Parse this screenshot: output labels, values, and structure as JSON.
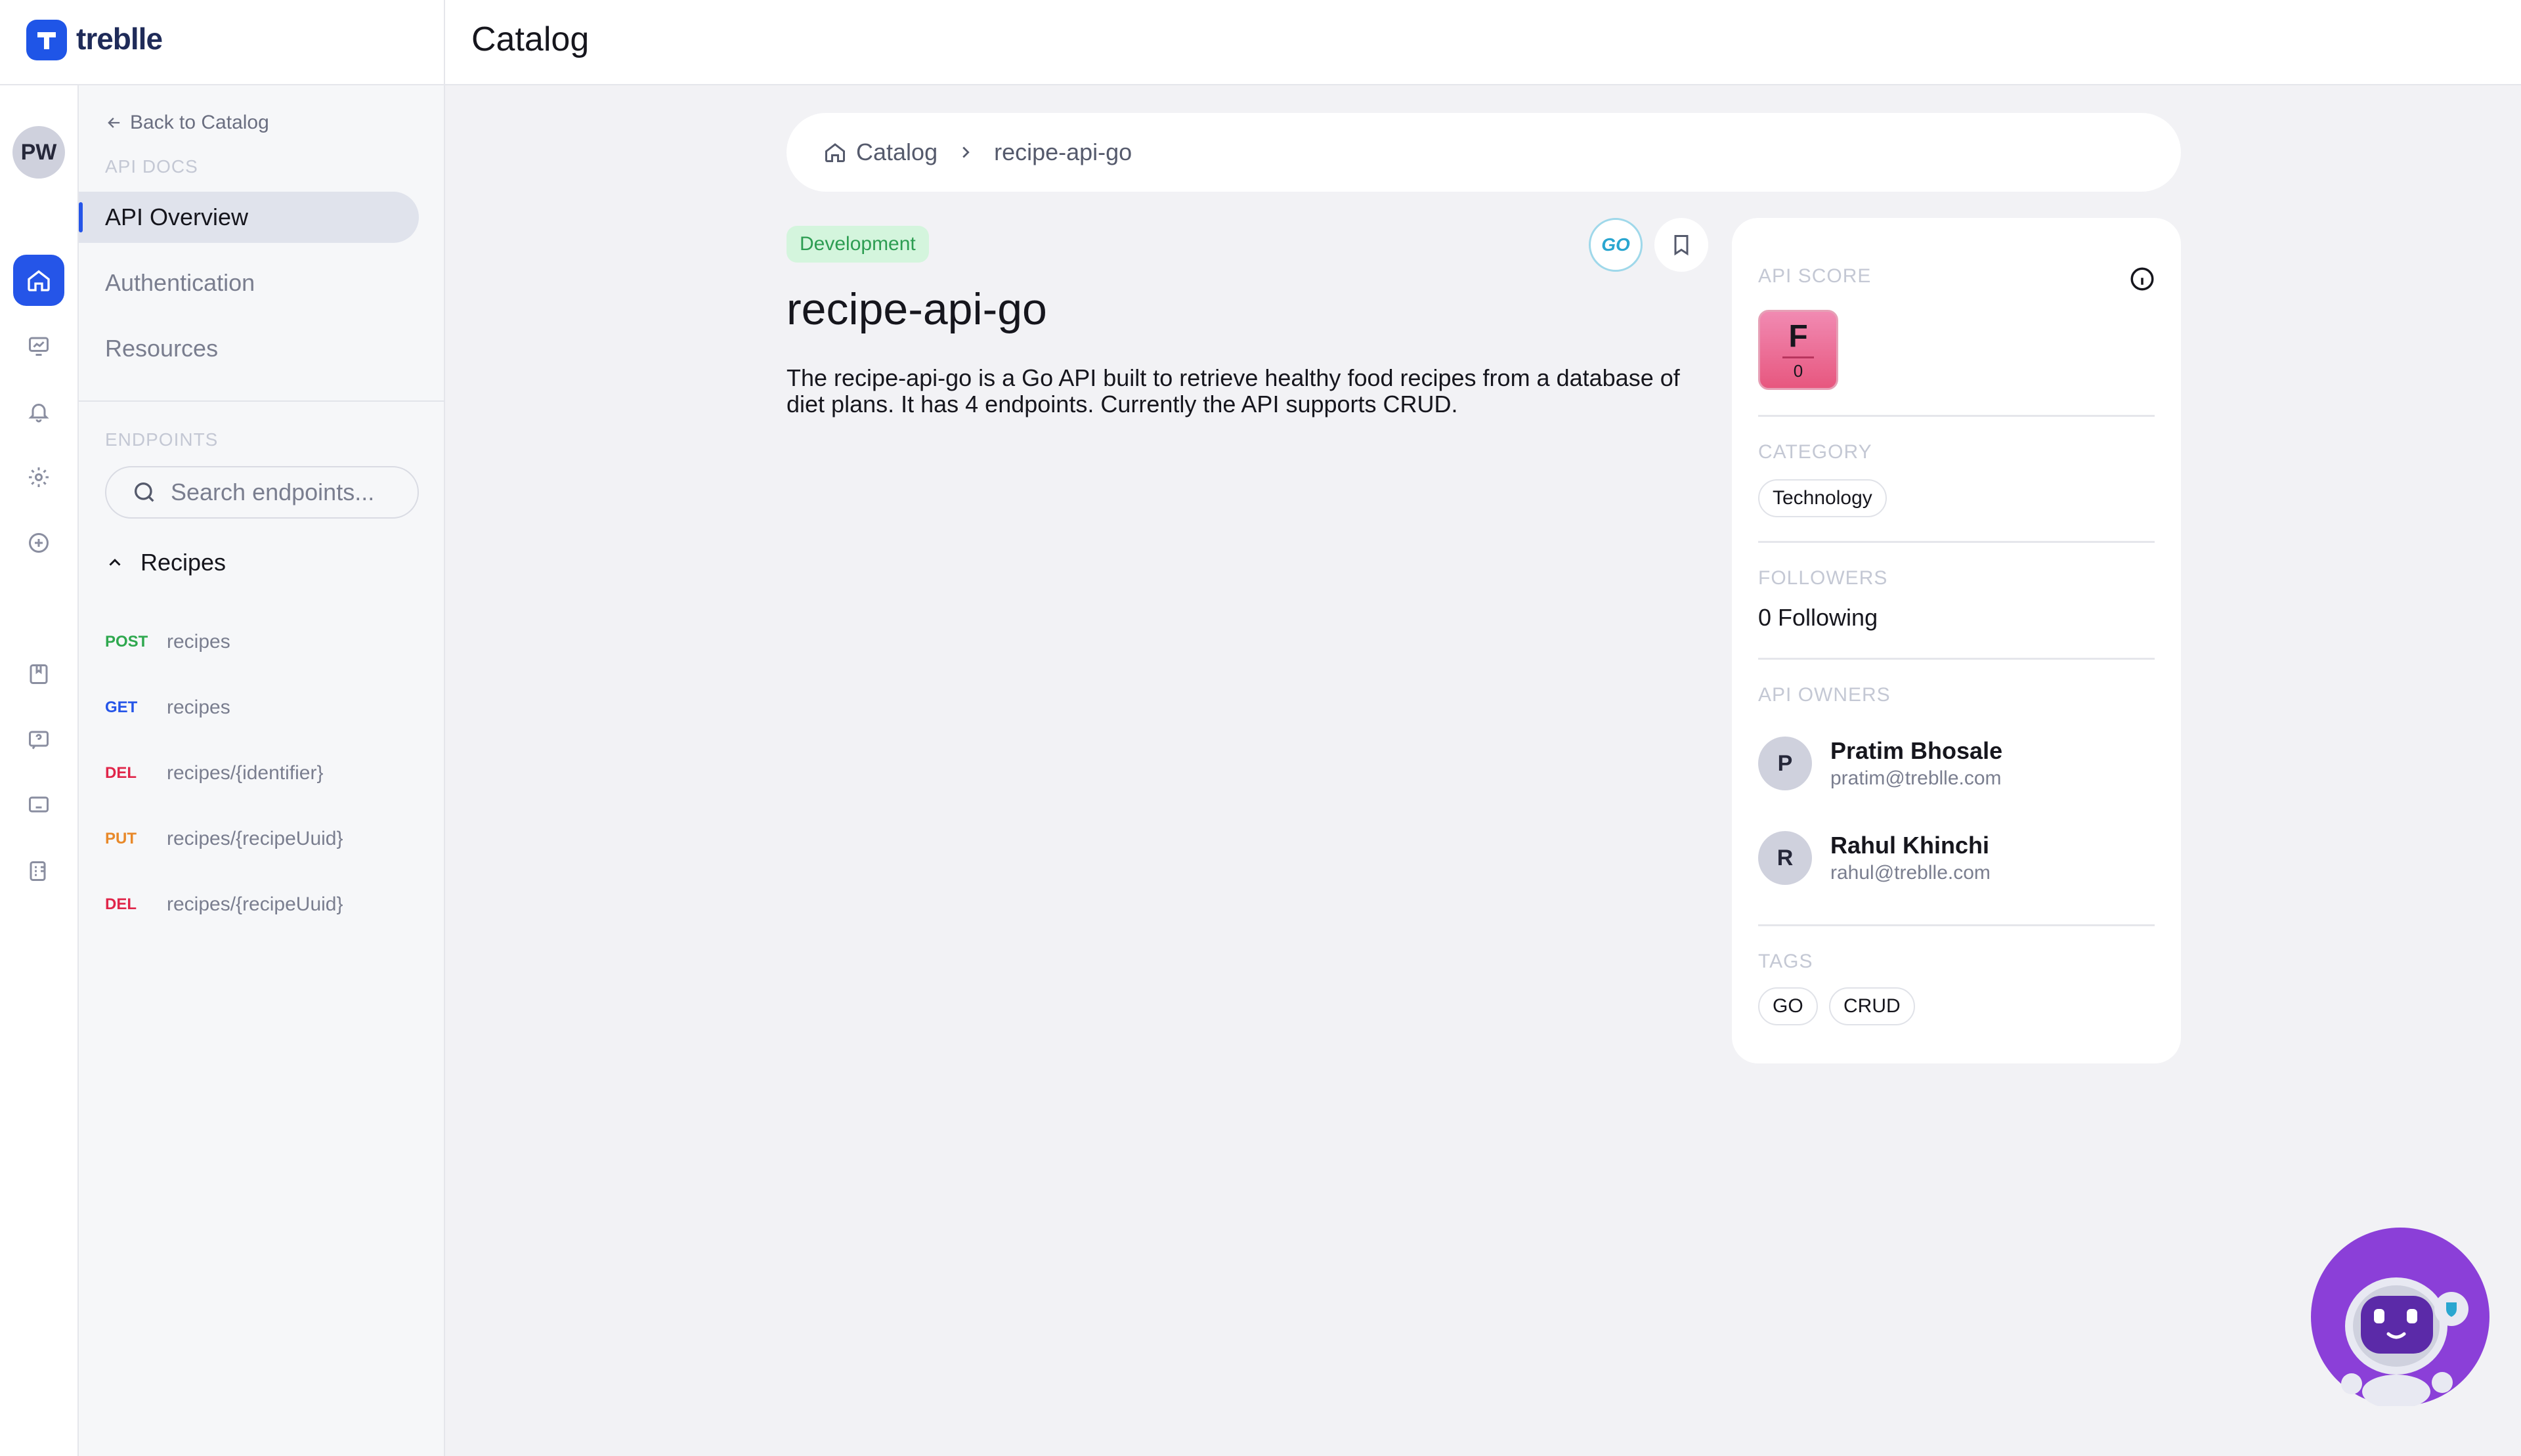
{
  "app": {
    "name": "treblle",
    "page_title": "Catalog"
  },
  "user": {
    "initials": "PW"
  },
  "sidebar": {
    "back_label": "Back to Catalog",
    "api_docs_label": "API DOCS",
    "nav": [
      {
        "label": "API Overview",
        "active": true
      },
      {
        "label": "Authentication",
        "active": false
      },
      {
        "label": "Resources",
        "active": false
      }
    ],
    "endpoints_label": "ENDPOINTS",
    "search_placeholder": "Search endpoints...",
    "group_label": "Recipes",
    "endpoints": [
      {
        "method": "POST",
        "path": "recipes",
        "color": "#2fa84f"
      },
      {
        "method": "GET",
        "path": "recipes",
        "color": "#2555e8"
      },
      {
        "method": "DEL",
        "path": "recipes/{identifier}",
        "color": "#e0264a"
      },
      {
        "method": "PUT",
        "path": "recipes/{recipeUuid}",
        "color": "#e8892a"
      },
      {
        "method": "DEL",
        "path": "recipes/{recipeUuid}",
        "color": "#e0264a"
      }
    ]
  },
  "breadcrumb": {
    "root": "Catalog",
    "current": "recipe-api-go"
  },
  "api": {
    "status": "Development",
    "name": "recipe-api-go",
    "description": "The recipe-api-go is a Go API built to retrieve healthy food recipes from a database of diet plans. It has 4 endpoints. Currently the API supports CRUD.",
    "language_icon": "GO"
  },
  "card": {
    "score_label": "API SCORE",
    "score_grade": "F",
    "score_value": "0",
    "category_label": "CATEGORY",
    "category": "Technology",
    "followers_label": "FOLLOWERS",
    "followers": "0 Following",
    "owners_label": "API OWNERS",
    "owners": [
      {
        "initial": "P",
        "name": "Pratim Bhosale",
        "email": "pratim@treblle.com"
      },
      {
        "initial": "R",
        "name": "Rahul Khinchi",
        "email": "rahul@treblle.com"
      }
    ],
    "tags_label": "TAGS",
    "tags": [
      "GO",
      "CRUD"
    ]
  },
  "colors": {
    "accent": "#2555e8",
    "dev_badge": "#d4f5dd",
    "assistant": "#8b3fd8"
  }
}
